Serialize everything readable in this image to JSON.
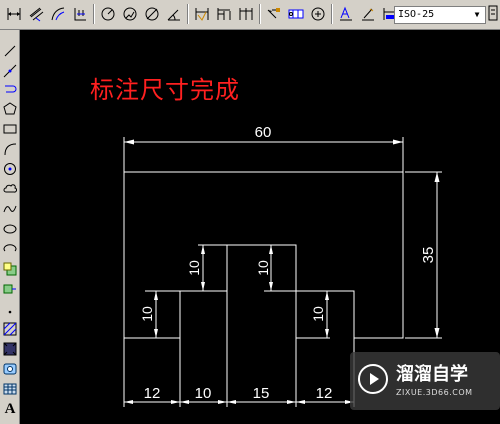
{
  "toolbar": {
    "buttons": [
      {
        "name": "linear-dimension-icon"
      },
      {
        "name": "aligned-dimension-icon"
      },
      {
        "name": "arc-length-dimension-icon"
      },
      {
        "name": "ordinate-dimension-icon"
      },
      {
        "name": "radius-dimension-icon"
      },
      {
        "name": "jogged-dimension-icon"
      },
      {
        "name": "diameter-dimension-icon"
      },
      {
        "name": "angular-dimension-icon"
      },
      {
        "name": "quick-dimension-icon"
      },
      {
        "name": "baseline-dimension-icon"
      },
      {
        "name": "continue-dimension-icon"
      },
      {
        "name": "quick-leader-icon"
      },
      {
        "name": "tolerance-icon"
      },
      {
        "name": "center-mark-icon"
      },
      {
        "name": "dimension-edit-icon"
      },
      {
        "name": "dimension-text-edit-icon"
      },
      {
        "name": "dimension-update-icon"
      }
    ],
    "dim_style_value": "ISO-25"
  },
  "sidebar": {
    "tools": [
      {
        "name": "line-icon"
      },
      {
        "name": "construction-line-icon"
      },
      {
        "name": "polyline-icon"
      },
      {
        "name": "polygon-icon"
      },
      {
        "name": "rectangle-icon"
      },
      {
        "name": "arc-icon"
      },
      {
        "name": "circle-icon"
      },
      {
        "name": "revision-cloud-icon"
      },
      {
        "name": "spline-icon"
      },
      {
        "name": "ellipse-icon"
      },
      {
        "name": "ellipse-arc-icon"
      },
      {
        "name": "insert-block-icon"
      },
      {
        "name": "make-block-icon"
      },
      {
        "name": "point-icon"
      },
      {
        "name": "hatch-icon"
      },
      {
        "name": "gradient-icon"
      },
      {
        "name": "region-icon"
      },
      {
        "name": "table-icon"
      }
    ],
    "text_tool_label": "A"
  },
  "canvas": {
    "note": "标注尺寸完成",
    "dimensions": {
      "overall_width": "60",
      "overall_height": "35",
      "left_step_height": "10",
      "center_step_height": "10",
      "center_block_height": "10",
      "right_step_height": "10",
      "seg_left": "12",
      "seg_step_left": "10",
      "seg_center": "15",
      "seg_step_right": "12"
    }
  },
  "watermark": {
    "title": "溜溜自学",
    "url": "ZIXUE.3D66.COM"
  },
  "colors": {
    "canvas_bg": "#000000",
    "drawing_line": "#ffffff",
    "note_text": "#ff2020",
    "ui_face": "#d4d0c8"
  }
}
